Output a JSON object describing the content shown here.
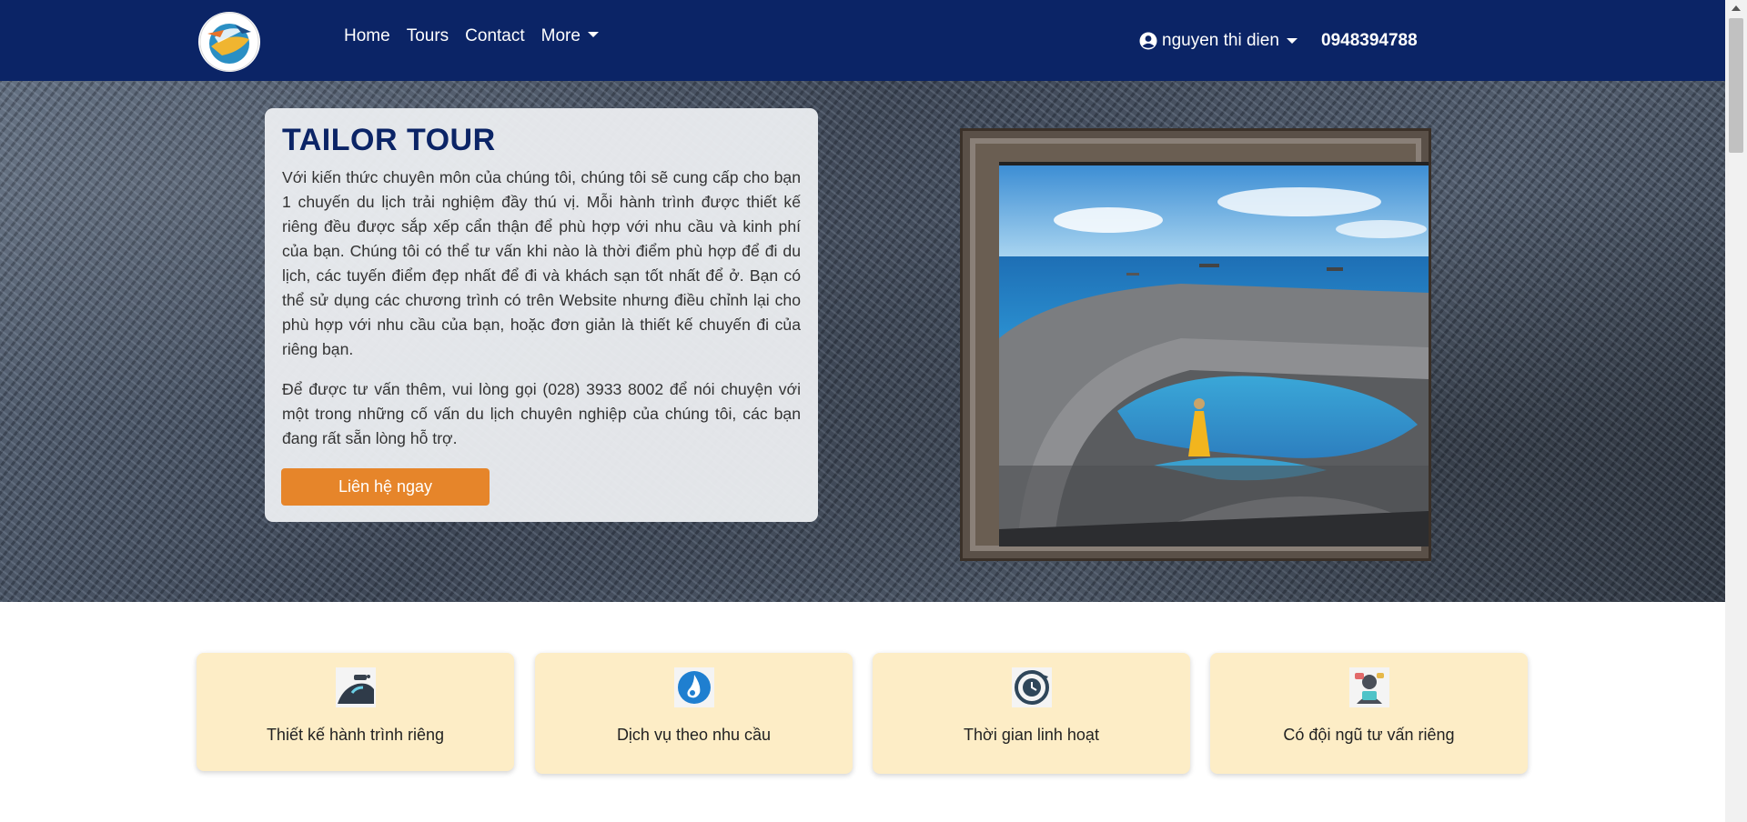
{
  "navbar": {
    "links": [
      "Home",
      "Tours",
      "Contact"
    ],
    "more_label": "More",
    "user_name": "nguyen thi dien",
    "phone": "0948394788"
  },
  "hero": {
    "title": "TAILOR TOUR",
    "paragraph_1": "Với kiến thức chuyên môn của chúng tôi, chúng tôi sẽ cung cấp cho bạn 1 chuyến du lịch trải nghiệm đầy thú vị. Mỗi hành trình được thiết kế riêng đều được sắp xếp cẩn thận để phù hợp với nhu cầu và kinh phí của bạn. Chúng tôi có thể tư vấn khi nào là thời điểm phù hợp để đi du lịch, các tuyến điểm đẹp nhất để đi và khách sạn tốt nhất để ở. Bạn có thể sử dụng các chương trình có trên Website nhưng điều chỉnh lại cho phù hợp với nhu cầu của bạn, hoặc đơn giản là thiết kế chuyến đi của riêng bạn.",
    "paragraph_2": "Để được tư vấn thêm, vui lòng gọi (028) 3933 8002 để nói chuyện với một trong những cố vấn du lịch chuyên nghiệp của chúng tôi, các bạn đang rất sẵn lòng hỗ trợ.",
    "cta_label": "Liên hệ ngay"
  },
  "features": [
    {
      "label": "Thiết kế hành trình riêng",
      "icon": "road-icon"
    },
    {
      "label": "Dịch vụ theo nhu cầu",
      "icon": "water-drop-icon"
    },
    {
      "label": "Thời gian linh hoạt",
      "icon": "clock-icon"
    },
    {
      "label": "Có đội ngũ tư vấn riêng",
      "icon": "consultant-icon"
    }
  ],
  "colors": {
    "navbar": "#0b2466",
    "accent_orange": "#e6852a",
    "feature_card": "#fdedc6"
  }
}
